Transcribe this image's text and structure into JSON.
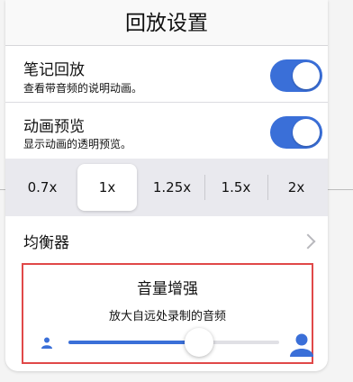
{
  "panel": {
    "title": "回放设置"
  },
  "settings": [
    {
      "title": "笔记回放",
      "subtitle": "查看带音频的说明动画。",
      "enabled": true
    },
    {
      "title": "动画预览",
      "subtitle": "显示动画的透明预览。",
      "enabled": true
    }
  ],
  "speed": {
    "options": [
      "0.7x",
      "1x",
      "1.25x",
      "1.5x",
      "2x"
    ],
    "selected": "1x"
  },
  "equalizer": {
    "label": "均衡器"
  },
  "volume_boost": {
    "title": "音量增强",
    "description": "放大自远处录制的音频",
    "level": 0.62
  },
  "colors": {
    "accent": "#3a6fd8",
    "highlight_border": "#e04848"
  },
  "icons": {
    "toggle_on": "toggle-on-icon",
    "chevron": "chevron-right-icon",
    "volume_low": "person-small-icon",
    "volume_high": "person-large-icon"
  }
}
